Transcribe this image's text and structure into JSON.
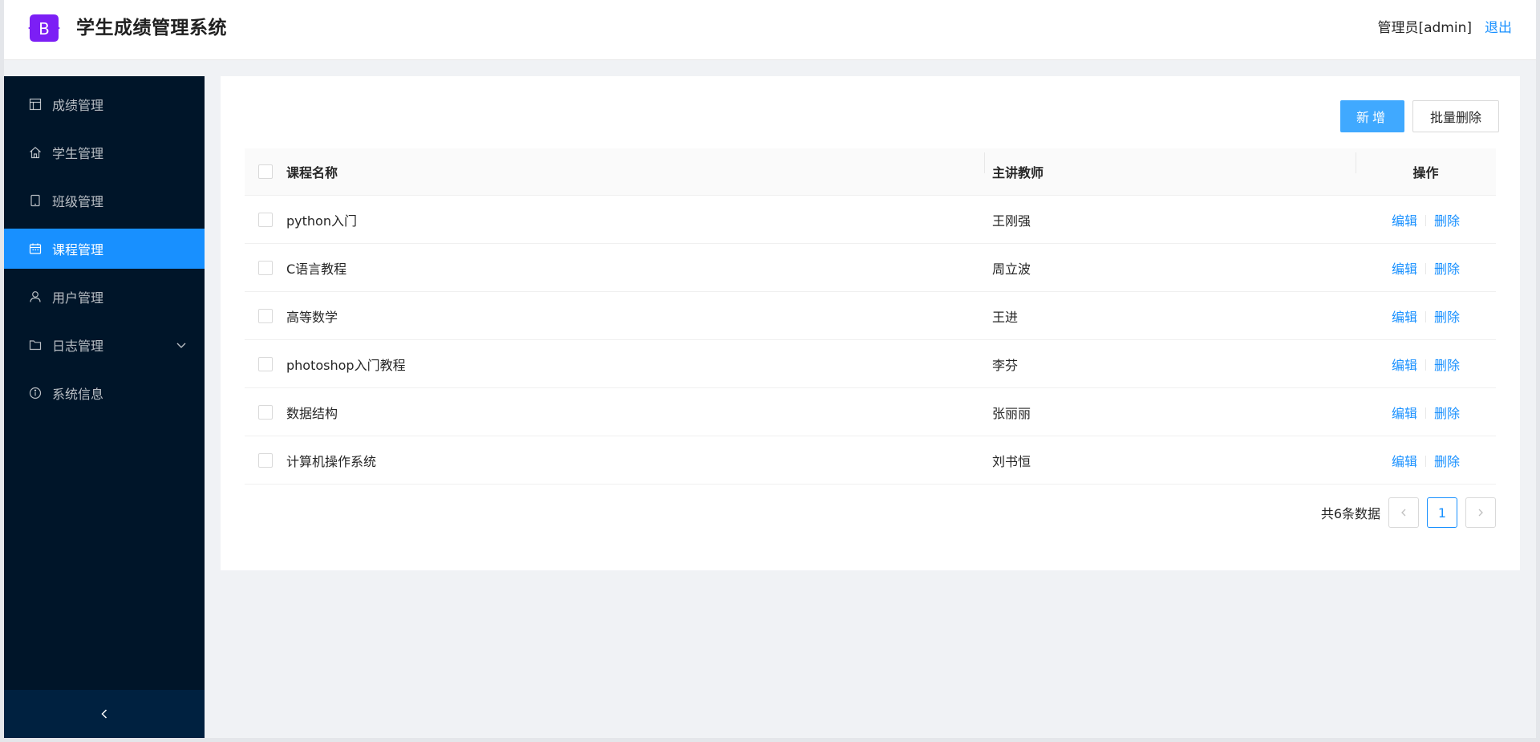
{
  "header": {
    "title": "学生成绩管理系统",
    "logo_letter": "B",
    "user": "管理员[admin]",
    "logout": "退出"
  },
  "sidebar": {
    "items": [
      {
        "label": "成绩管理",
        "icon": "table-icon",
        "active": false
      },
      {
        "label": "学生管理",
        "icon": "home-icon",
        "active": false
      },
      {
        "label": "班级管理",
        "icon": "tablet-icon",
        "active": false
      },
      {
        "label": "课程管理",
        "icon": "calendar-icon",
        "active": true
      },
      {
        "label": "用户管理",
        "icon": "user-icon",
        "active": false
      },
      {
        "label": "日志管理",
        "icon": "folder-icon",
        "active": false,
        "expandable": true
      },
      {
        "label": "系统信息",
        "icon": "info-circle-icon",
        "active": false
      }
    ]
  },
  "toolbar": {
    "add_label": "新增",
    "batch_delete_label": "批量删除"
  },
  "table": {
    "columns": [
      "课程名称",
      "主讲教师",
      "操作"
    ],
    "rows": [
      {
        "name": "python入门",
        "teacher": "王刚强"
      },
      {
        "name": "C语言教程",
        "teacher": "周立波"
      },
      {
        "name": "高等数学",
        "teacher": "王进"
      },
      {
        "name": "photoshop入门教程",
        "teacher": "李芬"
      },
      {
        "name": "数据结构",
        "teacher": "张丽丽"
      },
      {
        "name": "计算机操作系统",
        "teacher": "刘书恒"
      }
    ],
    "edit_label": "编辑",
    "delete_label": "删除"
  },
  "pagination": {
    "total": "共6条数据",
    "current_page": "1"
  },
  "colors": {
    "primary": "#1890ff",
    "sidebar_bg": "#001529",
    "logo_bg": "#7c1ff5"
  }
}
